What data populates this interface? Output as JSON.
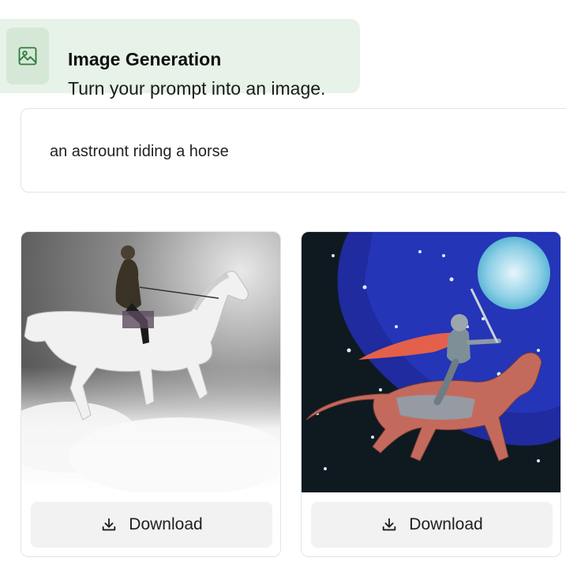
{
  "header": {
    "icon": "image-icon",
    "title": "Image Generation",
    "subtitle": "Turn your prompt into an image."
  },
  "prompt": {
    "text": "an astrount riding a horse"
  },
  "results": [
    {
      "image_description_icon": "generated-image",
      "download_label": "Download",
      "download_icon": "download-icon"
    },
    {
      "image_description_icon": "generated-image",
      "download_label": "Download",
      "download_icon": "download-icon"
    }
  ],
  "colors": {
    "header_bg": "#e7f2e8",
    "icon_accent": "#2e7d3e",
    "button_bg": "#f2f2f2"
  }
}
